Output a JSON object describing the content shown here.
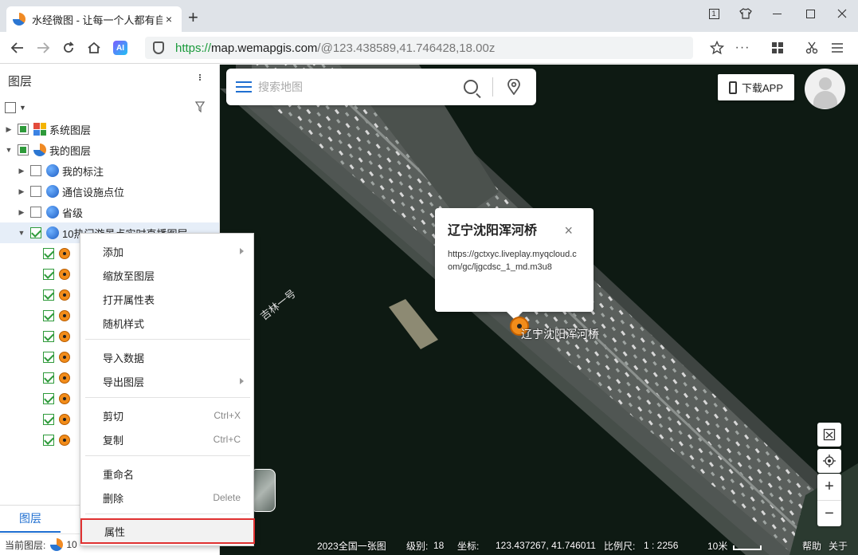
{
  "browser": {
    "tab_title": "水经微图 - 让每一个人都有自",
    "tab_close": "×",
    "new_tab": "+",
    "url_scheme": "https://",
    "url_host": "map.wemapgis.com",
    "url_path": "/@123.438589,41.746428,18.00z",
    "ai_label": "AI"
  },
  "sidebar": {
    "title": "图层",
    "tree": {
      "system_layers": "系统图层",
      "my_layers": "我的图层",
      "my_annotations": "我的标注",
      "comm_points": "通信设施点位",
      "province": "省级",
      "live_layer": "10热门游景点实时直播图层"
    },
    "bottom_tab": "图层",
    "status_label": "当前图层:",
    "status_value": "10"
  },
  "map": {
    "search_placeholder": "搜索地图",
    "download_label": "下载APP",
    "popup": {
      "title": "辽宁沈阳浑河桥",
      "close": "×",
      "url": "https://gctxyc.liveplay.myqcloud.com/gc/ljgcdsc_1_md.m3u8"
    },
    "marker_label": "辽宁沈阳浑河桥",
    "road_label": "吉林一号",
    "zoom_in": "+",
    "zoom_out": "−",
    "status": {
      "source": "2023全国一张图",
      "level_label": "级别:",
      "level_value": "18",
      "coord_label": "坐标:",
      "coord_value": "123.437267, 41.746011",
      "scale_label": "比例尺:",
      "scale_value": "1 : 2256",
      "scalebar_text": "10米",
      "help": "帮助",
      "about": "关于"
    }
  },
  "context_menu": {
    "add": "添加",
    "zoom_to_layer": "缩放至图层",
    "open_attr_table": "打开属性表",
    "random_style": "随机样式",
    "import_data": "导入数据",
    "export_layer": "导出图层",
    "cut": "剪切",
    "cut_shortcut": "Ctrl+X",
    "copy": "复制",
    "copy_shortcut": "Ctrl+C",
    "rename": "重命名",
    "delete": "删除",
    "delete_shortcut": "Delete",
    "properties": "属性"
  },
  "colors": {
    "accent": "#1f6fd1",
    "check_green": "#2e9a3a",
    "marker_orange": "#f28c1a",
    "highlight_red": "#e03131"
  }
}
